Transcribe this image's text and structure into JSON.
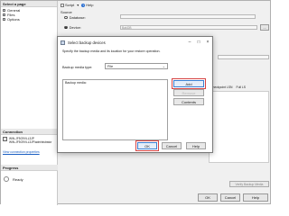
{
  "outer": {
    "left_pane": {
      "header": "Select a page",
      "pages": [
        "General",
        "Files",
        "Options"
      ]
    },
    "connection": {
      "header": "Connection",
      "lines": [
        "WIN-JF5O9VLL3JP",
        "WIN-JF5O9VLL3JP\\administrator"
      ],
      "link": "View connection properties"
    },
    "progress": {
      "header": "Progress",
      "status": "Ready"
    },
    "toolbar": {
      "script_label": "Script",
      "help_label": "Help"
    },
    "source": {
      "label": "Source",
      "database_label": "Database:",
      "device_label": "Device:",
      "device_value": "BakDB"
    },
    "destination_label": "Destination",
    "grid_headers": [
      "Checkpoint LSN",
      "Full LS"
    ],
    "ellipsis": "...",
    "verify_label": "Verify Backup Media",
    "buttons": {
      "ok": "OK",
      "cancel": "Cancel",
      "help": "Help"
    }
  },
  "dialog": {
    "title": "Select backup devices",
    "description": "Specify the backup media and its location for your restore operation.",
    "media_type_label": "Backup media type:",
    "media_type_value": "File",
    "backup_media_label": "Backup media:",
    "side_buttons": {
      "add": "Add",
      "remove": "Remove",
      "contents": "Contents"
    },
    "bottom_buttons": {
      "ok": "OK",
      "cancel": "Cancel",
      "help": "Help"
    }
  },
  "colors": {
    "highlight": "#d64545",
    "link": "#1a5ec2"
  }
}
